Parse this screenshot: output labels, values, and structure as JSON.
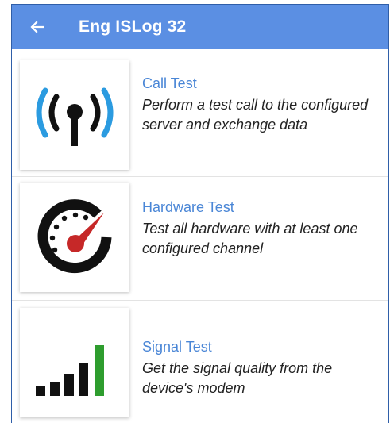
{
  "appbar": {
    "title": "Eng ISLog 32",
    "back_icon": "arrow-left-icon",
    "color": "#5b8fe3"
  },
  "tests": [
    {
      "name": "Call Test",
      "description": "Perform a test call to the configured server and exchange data",
      "icon": "antenna-broadcast-icon"
    },
    {
      "name": "Hardware Test",
      "description": "Test all hardware with at least one configured channel",
      "icon": "speedometer-icon"
    },
    {
      "name": "Signal Test",
      "description": "Get the signal quality from the device's modem",
      "icon": "signal-bars-icon"
    }
  ],
  "colors": {
    "link": "#4a86d6",
    "antenna_waves": "#2b9be0",
    "gauge_needle": "#c62828",
    "signal_full_bar": "#2e9d2e"
  }
}
